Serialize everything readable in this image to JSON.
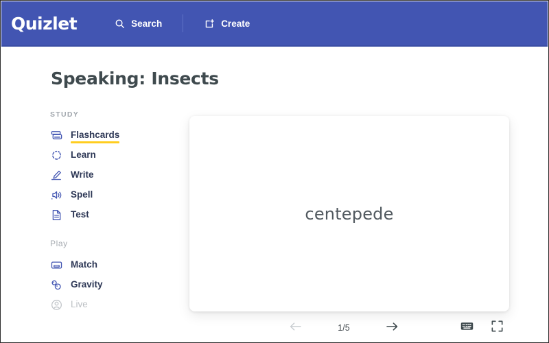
{
  "brand": {
    "logo_text": "Quizlet",
    "header_color": "#4255b2",
    "accent_color": "#ffcd1f",
    "icon_color": "#4255b2"
  },
  "header": {
    "search": {
      "label": "Search",
      "icon": "search-icon"
    },
    "create": {
      "label": "Create",
      "icon": "create-icon"
    }
  },
  "page": {
    "title": "Speaking: Insects"
  },
  "sidebar": {
    "study": {
      "label": "STUDY",
      "items": [
        {
          "label": "Flashcards",
          "icon": "flashcards-icon",
          "active": true,
          "disabled": false
        },
        {
          "label": "Learn",
          "icon": "learn-icon",
          "active": false,
          "disabled": false
        },
        {
          "label": "Write",
          "icon": "write-icon",
          "active": false,
          "disabled": false
        },
        {
          "label": "Spell",
          "icon": "spell-icon",
          "active": false,
          "disabled": false
        },
        {
          "label": "Test",
          "icon": "test-icon",
          "active": false,
          "disabled": false
        }
      ]
    },
    "play": {
      "label": "Play",
      "items": [
        {
          "label": "Match",
          "icon": "match-icon",
          "active": false,
          "disabled": false
        },
        {
          "label": "Gravity",
          "icon": "gravity-icon",
          "active": false,
          "disabled": false
        },
        {
          "label": "Live",
          "icon": "live-icon",
          "active": false,
          "disabled": true
        }
      ]
    }
  },
  "flashcard": {
    "term": "centepede"
  },
  "controls": {
    "previous_label": "",
    "next_label": "",
    "counter": "1/5",
    "current_index": 1,
    "total": 5,
    "keyboard_label": "",
    "fullscreen_label": ""
  }
}
